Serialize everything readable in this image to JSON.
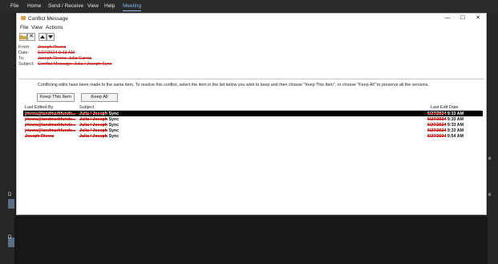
{
  "app_menu": {
    "file": "File",
    "home": "Home",
    "send_receive": "Send / Receive",
    "view": "View",
    "help": "Help",
    "meeting": "Meeting"
  },
  "background": {
    "right_label_1": "e",
    "right_label_2": "e",
    "left_glyph": "D"
  },
  "window": {
    "title": "Conflict Message",
    "controls": {
      "minimize": "—",
      "maximize": "☐",
      "close": "✕"
    },
    "menu": {
      "file": "File",
      "view": "View",
      "actions": "Actions"
    },
    "header": {
      "from_label": "From:",
      "from_value": "Joseph Rivera",
      "date_label": "Date:",
      "date_value": "6/27/2024 9:33 AM",
      "to_label": "To:",
      "to_value": "Joseph Rivera; Julia Garcia",
      "subject_label": "Subject:",
      "subject_value": "Conflict Message: Julia / Joseph Sync"
    },
    "message": "Conflicting edits have been made to the same item. To resolve this conflict, select the item in the list below you wish to keep and then choose \"Keep This Item\", or choose \"Keep All\" to preserve all the versions.",
    "buttons": {
      "keep_this": "Keep This Item",
      "keep_all": "Keep All"
    },
    "columns": {
      "edited_by": "Last Edited By",
      "subject": "Subject",
      "edit_date": "Last Edit Date"
    },
    "rows": [
      {
        "edited_by": "jrivera@landmarkfunde...",
        "subject_name": "Julia / Joseph",
        "subject_tail": " Sync",
        "date_red": "6/27/2024",
        "date_tail": " 9:33 AM"
      },
      {
        "edited_by": "jrivera@landmarkfunde...",
        "subject_name": "Julia / Joseph",
        "subject_tail": " Sync",
        "date_red": "6/27/2024",
        "date_tail": " 9:33 AM"
      },
      {
        "edited_by": "jrivera@landmarkfunde...",
        "subject_name": "Julia / Joseph",
        "subject_tail": " Sync",
        "date_red": "6/27/2024",
        "date_tail": " 9:33 AM"
      },
      {
        "edited_by": "jrivera@landmarkfunde...",
        "subject_name": "Julia / Joseph",
        "subject_tail": " Sync",
        "date_red": "6/27/2024",
        "date_tail": " 9:33 AM"
      },
      {
        "edited_by": "Joseph Rivera",
        "subject_name": "Julia / Joseph",
        "subject_tail": " Sync",
        "date_red": "6/27/2024",
        "date_tail": " 9:54 AM"
      }
    ]
  }
}
